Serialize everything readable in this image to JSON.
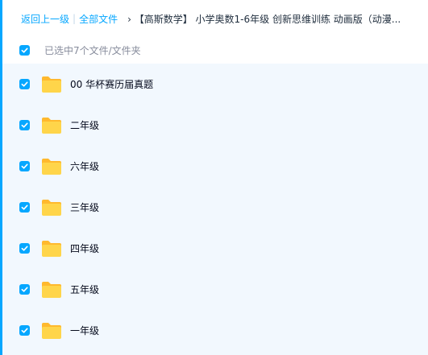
{
  "breadcrumb": {
    "back": "返回上一级",
    "separator": "|",
    "all_files": "全部文件",
    "arrow": "›",
    "current": "【高斯数学】 小学奥数1-6年级 创新思维训练 动画版（动漫..."
  },
  "selection": {
    "text": "已选中7个文件/文件夹"
  },
  "files": [
    {
      "name": "00 华杯赛历届真题",
      "checked": true
    },
    {
      "name": "二年级",
      "checked": true
    },
    {
      "name": "六年级",
      "checked": true
    },
    {
      "name": "三年级",
      "checked": true
    },
    {
      "name": "四年级",
      "checked": true
    },
    {
      "name": "五年级",
      "checked": true
    },
    {
      "name": "一年级",
      "checked": true
    }
  ],
  "colors": {
    "accent": "#06a7ff",
    "list_background": "#f2f8fe",
    "folder_front": "#ffd54a",
    "folder_back": "#ffb92e"
  },
  "icons": {
    "checkbox": "checkbox-checked-icon",
    "folder": "folder-icon"
  }
}
